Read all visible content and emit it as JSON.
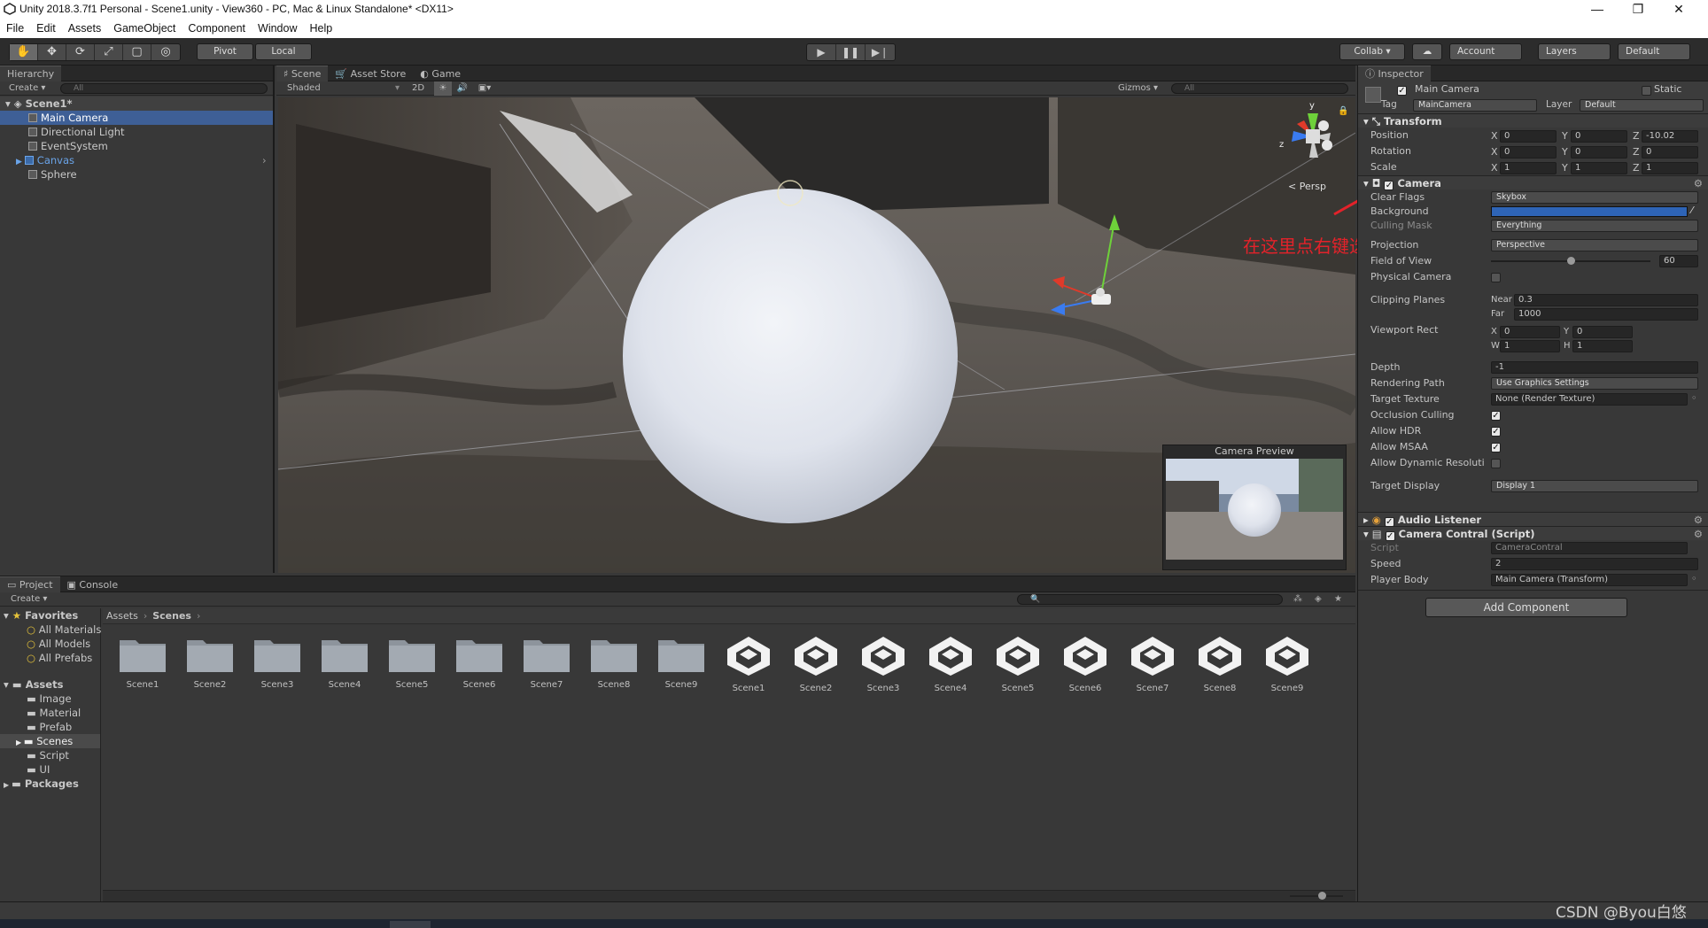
{
  "window": {
    "title": "Unity 2018.3.7f1 Personal - Scene1.unity - View360 - PC, Mac & Linux Standalone* <DX11>",
    "minimize": "—",
    "maximize": "❐",
    "close": "✕"
  },
  "menu": [
    "File",
    "Edit",
    "Assets",
    "GameObject",
    "Component",
    "Window",
    "Help"
  ],
  "toolbar": {
    "tools": [
      "✋",
      "✥",
      "⟳",
      "⤢",
      "▢",
      "◎"
    ],
    "pivot": "Pivot",
    "local": "Local",
    "play": "▶",
    "pause": "❚❚",
    "step": "▶❘",
    "collab": "Collab ▾",
    "cloud": "☁",
    "account": "Account",
    "layers": "Layers",
    "layout": "Default"
  },
  "hierarchy": {
    "tab": "Hierarchy",
    "create": "Create ▾",
    "search_placeholder": "All",
    "scene": "Scene1*",
    "items": [
      {
        "label": "Main Camera",
        "selected": true
      },
      {
        "label": "Directional Light"
      },
      {
        "label": "EventSystem"
      },
      {
        "label": "Canvas",
        "blue": true
      },
      {
        "label": "Sphere"
      }
    ]
  },
  "scene_view": {
    "tabs": [
      "Scene",
      "Asset Store",
      "Game"
    ],
    "shading": "Shaded",
    "mode_2d": "2D",
    "gizmos": "Gizmos ▾",
    "search_placeholder": "All",
    "persp": "< Persp",
    "axis_y": "y",
    "axis_z": "z",
    "camera_preview": "Camera Preview"
  },
  "annotation": {
    "text": "在这里点右键选择第一个Reset进行重置",
    "color": "#e3222a"
  },
  "inspector": {
    "tab": "Inspector",
    "object_name": "Main Camera",
    "static": "Static",
    "tag_label": "Tag",
    "tag": "MainCamera",
    "layer_label": "Layer",
    "layer": "Default",
    "transform": {
      "header": "Transform",
      "position_label": "Position",
      "rotation_label": "Rotation",
      "scale_label": "Scale",
      "position": {
        "x": "0",
        "y": "0",
        "z": "-10.02"
      },
      "rotation": {
        "x": "0",
        "y": "0",
        "z": "0"
      },
      "scale": {
        "x": "1",
        "y": "1",
        "z": "1"
      }
    },
    "camera": {
      "header": "Camera",
      "clear_flags_label": "Clear Flags",
      "clear_flags": "Skybox",
      "background_label": "Background",
      "culling_mask_label": "Culling Mask",
      "culling_mask": "Everything",
      "projection_label": "Projection",
      "projection": "Perspective",
      "fov_label": "Field of View",
      "fov": "60",
      "fov_fraction": 0.48,
      "physical_label": "Physical Camera",
      "clipping_label": "Clipping Planes",
      "near_label": "Near",
      "near": "0.3",
      "far_label": "Far",
      "far": "1000",
      "viewport_label": "Viewport Rect",
      "vx": "0",
      "vy": "0",
      "vw": "1",
      "vh": "1",
      "depth_label": "Depth",
      "depth": "-1",
      "render_path_label": "Rendering Path",
      "render_path": "Use Graphics Settings",
      "target_texture_label": "Target Texture",
      "target_texture": "None (Render Texture)",
      "occlusion_label": "Occlusion Culling",
      "hdr_label": "Allow HDR",
      "msaa_label": "Allow MSAA",
      "dyn_res_label": "Allow Dynamic Resoluti",
      "target_display_label": "Target Display",
      "target_display": "Display 1"
    },
    "audio": {
      "header": "Audio Listener"
    },
    "script": {
      "header": "Camera Contral (Script)",
      "script_label": "Script",
      "script": "CameraContral",
      "speed_label": "Speed",
      "speed": "2",
      "player_label": "Player Body",
      "player": "Main Camera (Transform)"
    },
    "add_component": "Add Component"
  },
  "project": {
    "tabs": [
      "Project",
      "Console"
    ],
    "create": "Create ▾",
    "favorites": "Favorites",
    "fav_items": [
      "All Materials",
      "All Models",
      "All Prefabs"
    ],
    "assets": "Assets",
    "asset_folders": [
      "Image",
      "Material",
      "Prefab",
      "Scenes",
      "Script",
      "UI"
    ],
    "packages": "Packages",
    "breadcrumb": [
      "Assets",
      "Scenes"
    ],
    "folders": [
      "Scene1",
      "Scene2",
      "Scene3",
      "Scene4",
      "Scene5",
      "Scene6",
      "Scene7",
      "Scene8",
      "Scene9"
    ],
    "scenes": [
      "Scene1",
      "Scene2",
      "Scene3",
      "Scene4",
      "Scene5",
      "Scene6",
      "Scene7",
      "Scene8",
      "Scene9"
    ]
  },
  "watermark": "CSDN @Byou白悠",
  "colors": {
    "selection": "#3e5f96",
    "annotation": "#e3222a",
    "bg_color": "#2e64b6"
  }
}
